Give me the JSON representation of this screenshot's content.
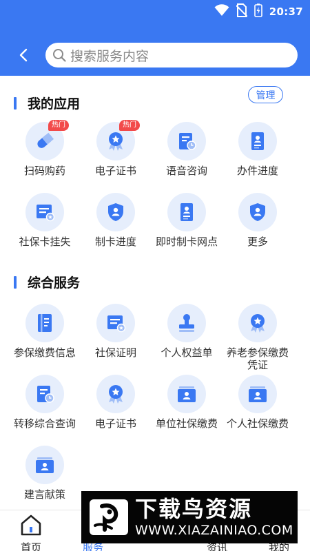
{
  "status_bar": {
    "time": "20:37"
  },
  "header": {
    "search_placeholder": "搜索服务内容",
    "accent": "#3a78f2"
  },
  "my_apps": {
    "title": "我的应用",
    "manage_label": "管理",
    "items": [
      {
        "label": "扫码购药",
        "icon": "pill-icon",
        "badge": "热门"
      },
      {
        "label": "电子证书",
        "icon": "medal-icon",
        "badge": "热门"
      },
      {
        "label": "语音咨询",
        "icon": "document-clock-icon"
      },
      {
        "label": "办件进度",
        "icon": "id-document-icon"
      },
      {
        "label": "社保卡挂失",
        "icon": "card-document-icon"
      },
      {
        "label": "制卡进度",
        "icon": "shield-person-icon"
      },
      {
        "label": "即时制卡网点",
        "icon": "id-document-icon"
      },
      {
        "label": "更多",
        "icon": "shield-person-icon"
      }
    ]
  },
  "general_services": {
    "title": "综合服务",
    "items": [
      {
        "label": "参保缴费信息",
        "icon": "notebook-icon"
      },
      {
        "label": "社保证明",
        "icon": "card-document-icon"
      },
      {
        "label": "个人权益单",
        "icon": "stamp-icon"
      },
      {
        "label": "养老参保缴费\n凭证",
        "icon": "medal-icon"
      },
      {
        "label": "转移综合查询",
        "icon": "document-clock-icon"
      },
      {
        "label": "电子证书",
        "icon": "medal-icon"
      },
      {
        "label": "单位社保缴费",
        "icon": "person-card-icon"
      },
      {
        "label": "个人社保缴费",
        "icon": "person-card-icon"
      },
      {
        "label": "建言献策",
        "icon": "person-card-icon"
      }
    ]
  },
  "bottom_nav": {
    "items": [
      {
        "label": "首页",
        "icon": "home-icon",
        "active": false
      },
      {
        "label": "服务",
        "icon": "service-icon",
        "active": true
      },
      {
        "label": "",
        "icon": "scan-icon",
        "active": false
      },
      {
        "label": "资讯",
        "icon": "news-icon",
        "active": false
      },
      {
        "label": "我的",
        "icon": "profile-icon",
        "active": false
      }
    ]
  },
  "watermark": {
    "title": "下载鸟资源",
    "url": "WWW.XIAZAINIAO.COM"
  }
}
